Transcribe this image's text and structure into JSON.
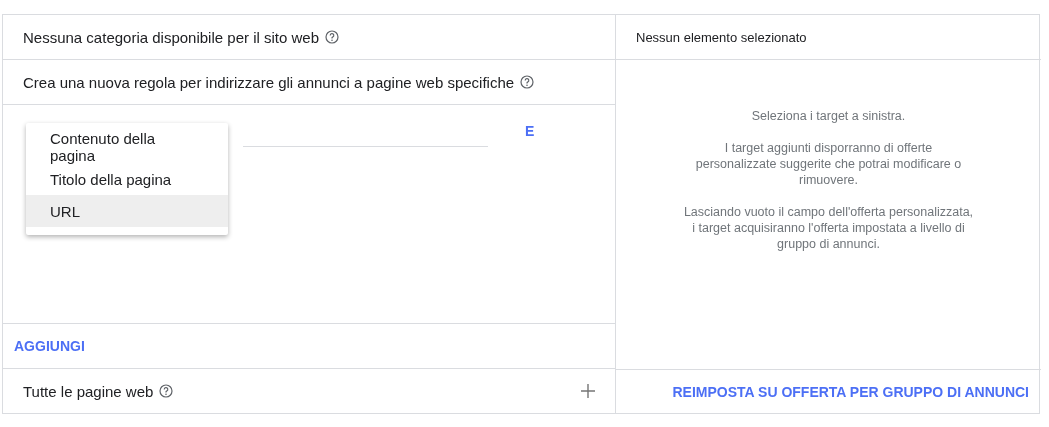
{
  "left": {
    "category_row": {
      "label": "Nessuna categoria disponibile per il sito web"
    },
    "rule_row": {
      "label": "Crea una nuova regola per indirizzare gli annunci a pagine web specifiche"
    },
    "rule_editor": {
      "menu": [
        {
          "label": "Contenuto della pagina",
          "selected": false
        },
        {
          "label": "Titolo della pagina",
          "selected": false
        },
        {
          "label": "URL",
          "selected": true
        }
      ],
      "operator_button": "E"
    },
    "add_button": "AGGIUNGI",
    "all_pages_row": {
      "label": "Tutte le pagine web"
    }
  },
  "right": {
    "header": "Nessun elemento selezionato",
    "messages": [
      "Seleziona i target a sinistra.",
      "I target aggiunti disporranno di offerte personalizzate suggerite che potrai modificare o rimuovere.",
      "Lasciando vuoto il campo dell'offerta personalizzata, i target acquisiranno l'offerta impostata a livello di gruppo di annunci."
    ],
    "reset_button": "REIMPOSTA SU OFFERTA PER GRUPPO DI ANNUNCI"
  }
}
